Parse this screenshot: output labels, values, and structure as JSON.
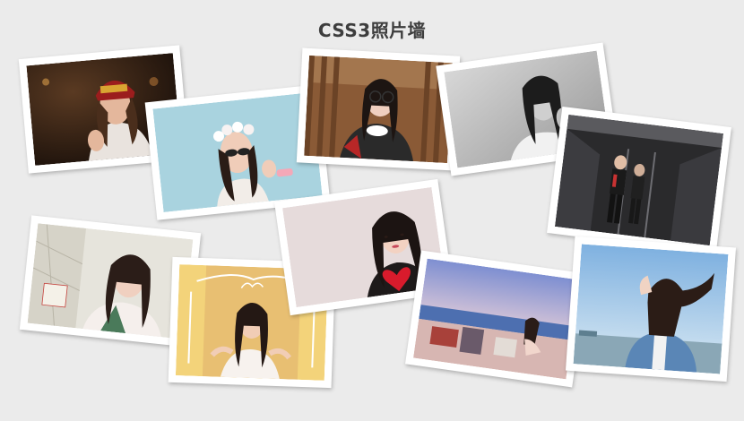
{
  "page": {
    "title": "CSS3照片墙"
  },
  "photos": [
    {
      "name": "photo-fendi-cap",
      "palette": "warm-dark"
    },
    {
      "name": "photo-flower-crown",
      "palette": "sky-blue"
    },
    {
      "name": "photo-glasses-tea",
      "palette": "warm-brown"
    },
    {
      "name": "photo-bw-portrait",
      "palette": "grayscale"
    },
    {
      "name": "photo-street-outfit",
      "palette": "dark-interior"
    },
    {
      "name": "photo-window-calendar",
      "palette": "soft-cream"
    },
    {
      "name": "photo-love-sign",
      "palette": "yellow"
    },
    {
      "name": "photo-red-heart",
      "palette": "pale-rose"
    },
    {
      "name": "photo-seaside-lounge",
      "palette": "sunset-sea"
    },
    {
      "name": "photo-denim-jacket",
      "palette": "cool-blue"
    }
  ],
  "colors": {
    "background": "#ebebeb",
    "frame": "#ffffff",
    "title": "#3d3d3d"
  }
}
